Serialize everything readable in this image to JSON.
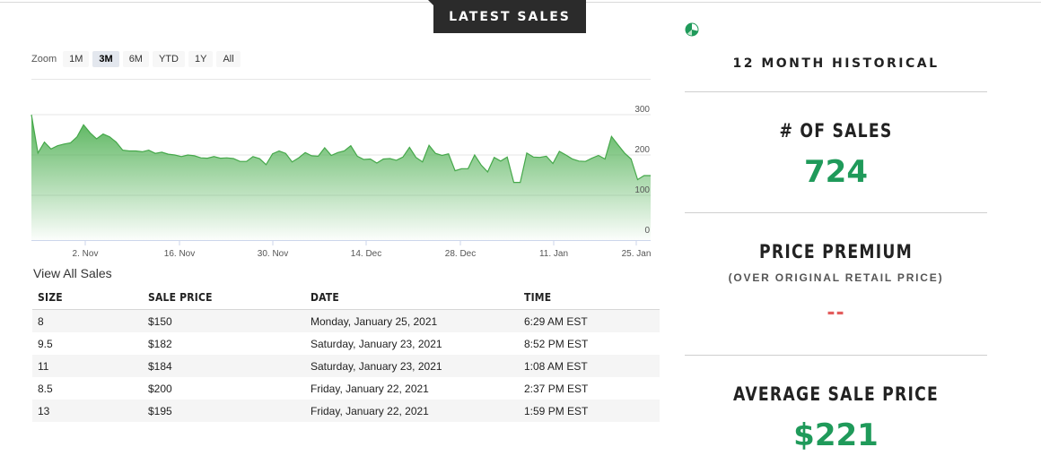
{
  "header": {
    "tab_label": "LATEST SALES"
  },
  "zoom": {
    "label": "Zoom",
    "options": [
      "1M",
      "3M",
      "6M",
      "YTD",
      "1Y",
      "All"
    ],
    "selected": "3M"
  },
  "chart_data": {
    "type": "area",
    "color": "#4caf50",
    "x_ticks": [
      "2. Nov",
      "16. Nov",
      "30. Nov",
      "14. Dec",
      "28. Dec",
      "11. Jan",
      "25. Jan"
    ],
    "y_ticks": [
      0,
      100,
      200,
      300
    ],
    "ylim": [
      0,
      300
    ],
    "grid": true,
    "values": [
      300,
      205,
      232,
      215,
      223,
      227,
      230,
      245,
      275,
      255,
      240,
      252,
      245,
      232,
      212,
      210,
      210,
      208,
      212,
      204,
      207,
      202,
      200,
      196,
      200,
      198,
      193,
      192,
      196,
      192,
      193,
      191,
      184,
      184,
      196,
      191,
      176,
      203,
      210,
      204,
      183,
      193,
      206,
      198,
      197,
      218,
      199,
      206,
      210,
      223,
      197,
      189,
      190,
      180,
      190,
      191,
      187,
      195,
      219,
      194,
      183,
      224,
      204,
      199,
      203,
      161,
      166,
      166,
      200,
      175,
      158,
      194,
      185,
      195,
      132,
      132,
      205,
      195,
      194,
      197,
      179,
      209,
      200,
      190,
      185,
      184,
      192,
      199,
      190,
      246,
      225,
      205,
      190,
      139,
      149,
      149
    ],
    "title": "",
    "xlabel": "",
    "ylabel": ""
  },
  "view_all": "View All Sales",
  "table": {
    "headers": [
      "SIZE",
      "SALE PRICE",
      "DATE",
      "TIME"
    ],
    "rows": [
      [
        "8",
        "$150",
        "Monday, January 25, 2021",
        "6:29 AM EST"
      ],
      [
        "9.5",
        "$182",
        "Saturday, January 23, 2021",
        "8:52 PM EST"
      ],
      [
        "11",
        "$184",
        "Saturday, January 23, 2021",
        "1:08 AM EST"
      ],
      [
        "8.5",
        "$200",
        "Friday, January 22, 2021",
        "2:37 PM EST"
      ],
      [
        "13",
        "$195",
        "Friday, January 22, 2021",
        "1:59 PM EST"
      ]
    ]
  },
  "stats": {
    "icon": "pie-chart-icon",
    "period_title": "12 MONTH HISTORICAL",
    "sales_label": "# OF SALES",
    "sales_value": "724",
    "premium_label": "PRICE PREMIUM",
    "premium_sub": "(OVER ORIGINAL RETAIL PRICE)",
    "premium_value": "--",
    "avg_label": "AVERAGE SALE PRICE",
    "avg_value": "$221",
    "value_color": "#1f9a5a",
    "dash_color": "#e35d5d"
  }
}
